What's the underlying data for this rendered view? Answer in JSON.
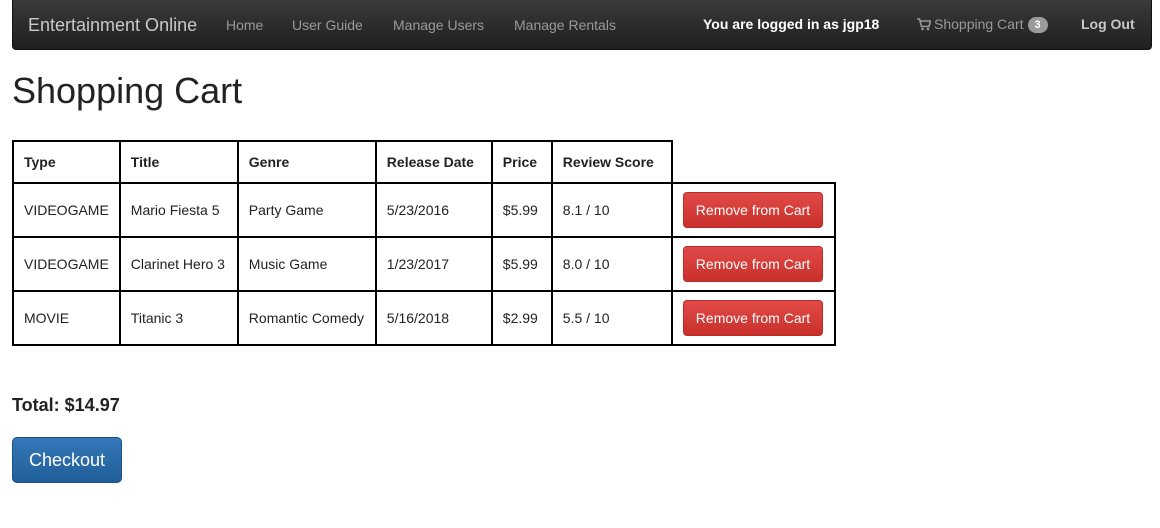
{
  "navbar": {
    "brand": "Entertainment Online",
    "links": [
      {
        "label": "Home"
      },
      {
        "label": "User Guide"
      },
      {
        "label": "Manage Users"
      },
      {
        "label": "Manage Rentals"
      }
    ],
    "logged_in_text": "You are logged in as jgp18",
    "cart_label": "Shopping Cart",
    "cart_count": "3",
    "cart_icon": "shopping-cart-icon",
    "logout_label": "Log Out"
  },
  "page": {
    "title": "Shopping Cart"
  },
  "table": {
    "headers": [
      "Type",
      "Title",
      "Genre",
      "Release Date",
      "Price",
      "Review Score"
    ],
    "rows": [
      [
        "VIDEOGAME",
        "Mario Fiesta 5",
        "Party Game",
        "5/23/2016",
        "$5.99",
        "8.1 / 10"
      ],
      [
        "VIDEOGAME",
        "Clarinet Hero 3",
        "Music Game",
        "1/23/2017",
        "$5.99",
        "8.0 / 10"
      ],
      [
        "MOVIE",
        "Titanic 3",
        "Romantic Comedy",
        "5/16/2018",
        "$2.99",
        "5.5 / 10"
      ]
    ],
    "remove_label": "Remove from Cart"
  },
  "total": "Total: $14.97",
  "checkout_label": "Checkout",
  "colors": {
    "navbar_bg": "#222222",
    "danger": "#d9534f",
    "primary": "#286090"
  }
}
